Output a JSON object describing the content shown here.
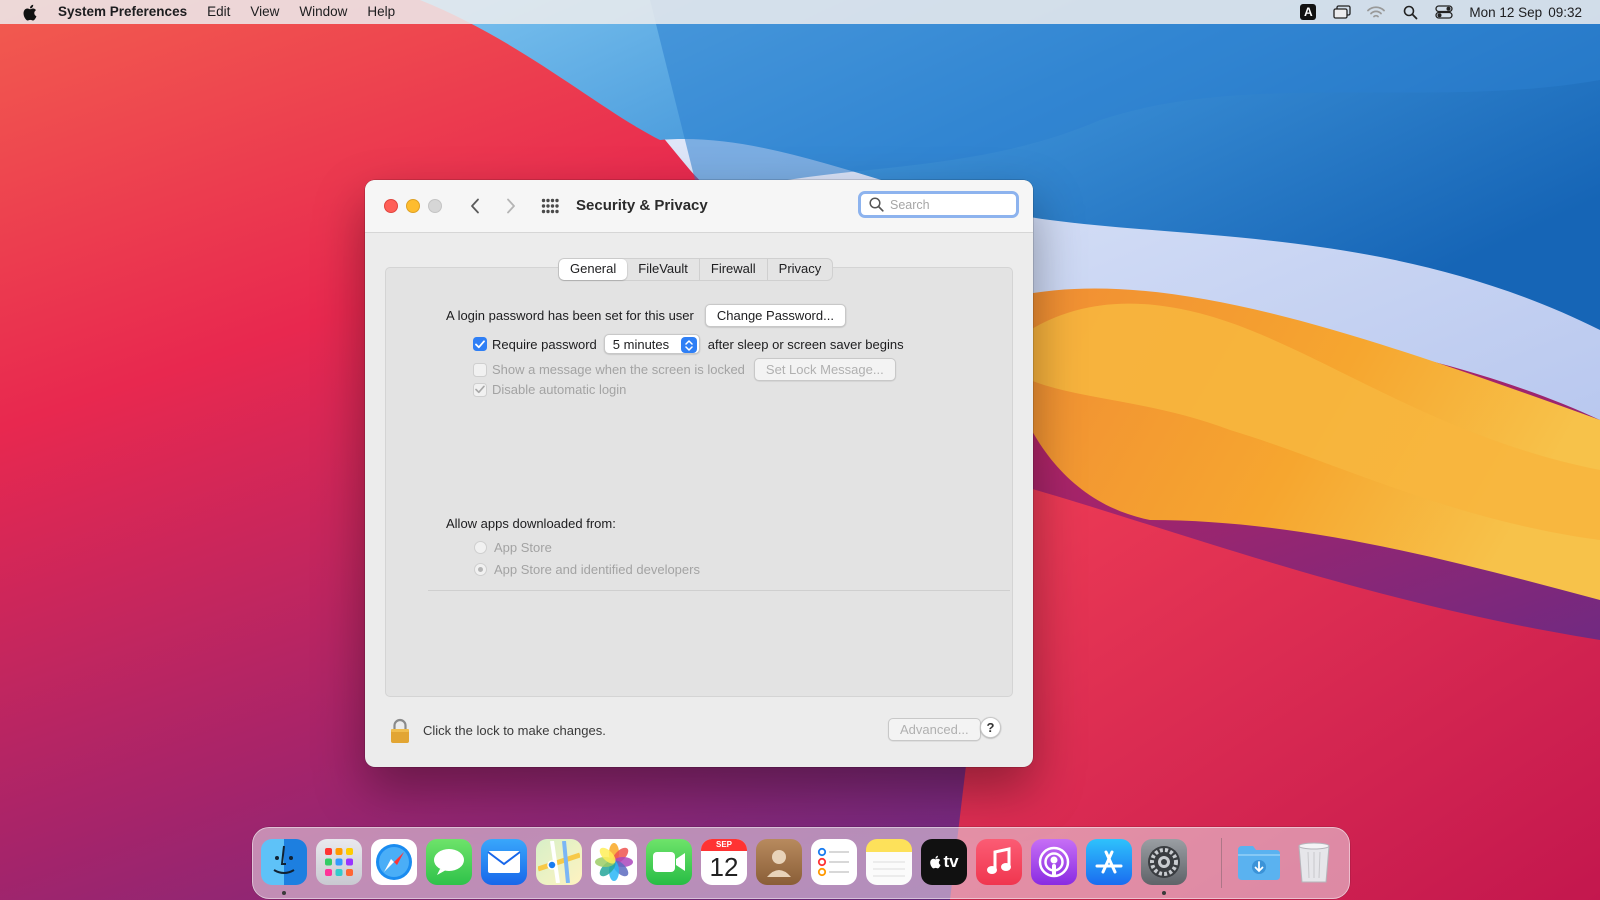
{
  "menubar": {
    "app_name": "System Preferences",
    "menus": [
      "Edit",
      "View",
      "Window",
      "Help"
    ],
    "input_source": "A",
    "clock": {
      "date": "Mon 12 Sep",
      "time": "09:32"
    }
  },
  "window": {
    "title": "Security & Privacy",
    "search_placeholder": "Search",
    "tabs": [
      {
        "label": "General",
        "active": true
      },
      {
        "label": "FileVault",
        "active": false
      },
      {
        "label": "Firewall",
        "active": false
      },
      {
        "label": "Privacy",
        "active": false
      }
    ],
    "general": {
      "login_password_text": "A login password has been set for this user",
      "change_password_label": "Change Password...",
      "require_password": {
        "label": "Require password",
        "checked": true,
        "delay_value": "5 minutes",
        "suffix": "after sleep or screen saver begins"
      },
      "show_message": {
        "label": "Show a message when the screen is locked",
        "checked": false,
        "enabled": false,
        "button_label": "Set Lock Message..."
      },
      "disable_auto_login": {
        "label": "Disable automatic login",
        "checked": true,
        "enabled": false
      },
      "allow_apps_label": "Allow apps downloaded from:",
      "allow_options": [
        {
          "label": "App Store",
          "selected": false
        },
        {
          "label": "App Store and identified developers",
          "selected": true
        }
      ]
    },
    "footer": {
      "lock_text": "Click the lock to make changes.",
      "advanced_label": "Advanced...",
      "help_label": "?"
    }
  },
  "dock": {
    "calendar": {
      "month": "SEP",
      "day": "12"
    },
    "tv_label": "tv",
    "apps": [
      "Finder",
      "Launchpad",
      "Safari",
      "Messages",
      "Mail",
      "Maps",
      "Photos",
      "FaceTime",
      "Calendar",
      "Contacts",
      "Reminders",
      "Notes",
      "Apple TV",
      "Music",
      "Podcasts",
      "App Store",
      "System Preferences",
      "Downloads",
      "Trash"
    ],
    "running": [
      "Finder",
      "System Preferences"
    ]
  },
  "colors": {
    "accent": "#2f7ff5",
    "close": "#ff5f57",
    "minimize": "#febc2e",
    "zoom_disabled": "#d6d6d6"
  }
}
